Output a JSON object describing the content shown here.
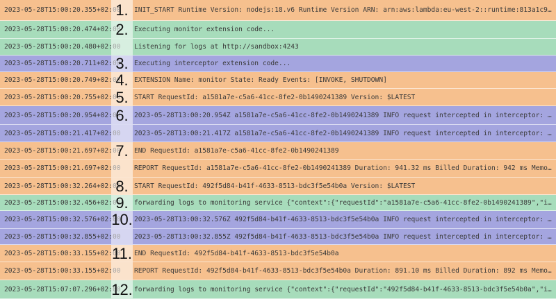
{
  "colors": {
    "orange": "#f6c08e",
    "green": "#a7dcbb",
    "purple": "#a4a5df"
  },
  "rows": [
    {
      "color": "orange",
      "ts": "2023-05-28T15:00:20.355+02:00",
      "msg": "INIT_START Runtime Version: nodejs:18.v6 Runtime Version ARN: arn:aws:lambda:eu-west-2::runtime:813a1c9d8f27c16e2f…"
    },
    {
      "color": "green",
      "ts": "2023-05-28T15:00:20.474+02:00",
      "msg": "Executing monitor extension code..."
    },
    {
      "color": "green",
      "ts": "2023-05-28T15:00:20.480+02:00",
      "msg": "Listening for logs at http://sandbox:4243"
    },
    {
      "color": "purple",
      "ts": "2023-05-28T15:00:20.711+02:00",
      "msg": "Executing interceptor extension code..."
    },
    {
      "color": "orange",
      "ts": "2023-05-28T15:00:20.749+02:00",
      "msg": "EXTENSION Name: monitor State: Ready Events: [INVOKE, SHUTDOWN]"
    },
    {
      "color": "orange",
      "ts": "2023-05-28T15:00:20.755+02:00",
      "msg": "START RequestId: a1581a7e-c5a6-41cc-8fe2-0b1490241389 Version: $LATEST"
    },
    {
      "color": "purple",
      "ts": "2023-05-28T15:00:20.954+02:00",
      "msg": "2023-05-28T13:00:20.954Z a1581a7e-c5a6-41cc-8fe2-0b1490241389 INFO request intercepted in interceptor: GET https:/…"
    },
    {
      "color": "purple",
      "ts": "2023-05-28T15:00:21.417+02:00",
      "msg": "2023-05-28T13:00:21.417Z a1581a7e-c5a6-41cc-8fe2-0b1490241389 INFO request intercepted in interceptor: POST https…"
    },
    {
      "color": "orange",
      "ts": "2023-05-28T15:00:21.697+02:00",
      "msg": "END RequestId: a1581a7e-c5a6-41cc-8fe2-0b1490241389"
    },
    {
      "color": "orange",
      "ts": "2023-05-28T15:00:21.697+02:00",
      "msg": "REPORT RequestId: a1581a7e-c5a6-41cc-8fe2-0b1490241389 Duration: 941.32 ms Billed Duration: 942 ms Memory Size: 25…"
    },
    {
      "color": "orange",
      "ts": "2023-05-28T15:00:32.264+02:00",
      "msg": "START RequestId: 492f5d84-b41f-4633-8513-bdc3f5e54b0a Version: $LATEST"
    },
    {
      "color": "green",
      "ts": "2023-05-28T15:00:32.456+02:00",
      "msg": "forwarding logs to monitoring service {\"context\":{\"requestId\":\"a1581a7e-c5a6-41cc-8fe2-0b1490241389\",\"invokedFunct…"
    },
    {
      "color": "purple",
      "ts": "2023-05-28T15:00:32.576+02:00",
      "msg": "2023-05-28T13:00:32.576Z 492f5d84-b41f-4633-8513-bdc3f5e54b0a INFO request intercepted in interceptor: GET https:/…"
    },
    {
      "color": "purple",
      "ts": "2023-05-28T15:00:32.855+02:00",
      "msg": "2023-05-28T13:00:32.855Z 492f5d84-b41f-4633-8513-bdc3f5e54b0a INFO request intercepted in interceptor: POST https…"
    },
    {
      "color": "orange",
      "ts": "2023-05-28T15:00:33.155+02:00",
      "msg": "END RequestId: 492f5d84-b41f-4633-8513-bdc3f5e54b0a"
    },
    {
      "color": "orange",
      "ts": "2023-05-28T15:00:33.155+02:00",
      "msg": "REPORT RequestId: 492f5d84-b41f-4633-8513-bdc3f5e54b0a Duration: 891.10 ms Billed Duration: 892 ms Memory Size: 25…"
    },
    {
      "color": "green",
      "ts": "2023-05-28T15:07:07.296+02:00",
      "msg": "forwarding logs to monitoring service {\"context\":{\"requestId\":\"492f5d84-b41f-4633-8513-bdc3f5e54b0a\",\"invokedFunct…"
    }
  ],
  "markers": [
    {
      "label": "1.",
      "from": 0,
      "to": 0
    },
    {
      "label": "2.",
      "from": 1,
      "to": 1
    },
    {
      "label": "3.",
      "from": 3,
      "to": 3
    },
    {
      "label": "4.",
      "from": 4,
      "to": 4
    },
    {
      "label": "5.",
      "from": 5,
      "to": 5
    },
    {
      "label": "6.",
      "from": 6,
      "to": 6
    },
    {
      "label": "7.",
      "from": 8,
      "to": 8
    },
    {
      "label": "8.",
      "from": 10,
      "to": 10
    },
    {
      "label": "9.",
      "from": 11,
      "to": 11
    },
    {
      "label": "10.",
      "from": 12,
      "to": 12
    },
    {
      "label": "11.",
      "from": 14,
      "to": 14
    },
    {
      "label": "12.",
      "from": 16,
      "to": 16
    }
  ]
}
